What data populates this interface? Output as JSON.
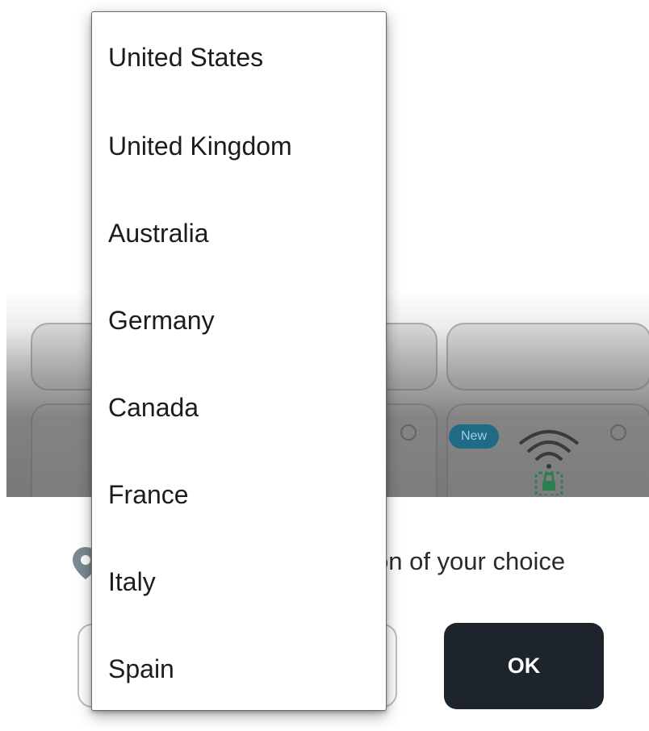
{
  "dropdown": {
    "options": [
      "United States",
      "United Kingdom",
      "Australia",
      "Germany",
      "Canada",
      "France",
      "Italy",
      "Spain"
    ]
  },
  "hero": {
    "new_badge": "New"
  },
  "location": {
    "text_visible": "on of your choice"
  },
  "actions": {
    "ok_label": "OK"
  },
  "colors": {
    "ok_button_bg": "#1e242b",
    "badge_bg": "#1f6b86"
  },
  "icons": {
    "pin": "location-pin-icon",
    "wifi": "wifi-lock-icon"
  }
}
